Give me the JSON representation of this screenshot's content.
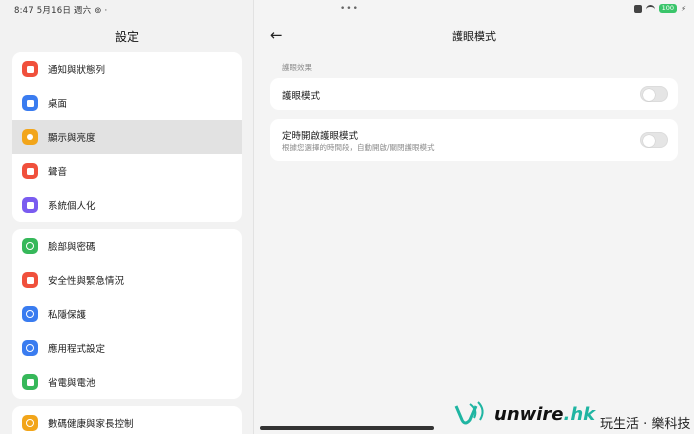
{
  "status": {
    "time_date": "8:47  5月16日 週六  ⊚ ·",
    "battery": "100",
    "dots": "•••"
  },
  "left": {
    "title": "設定",
    "groups": [
      [
        {
          "label": "通知與狀態列",
          "icon": "notification-icon",
          "color": "#f0503c"
        },
        {
          "label": "桌面",
          "icon": "home-icon",
          "color": "#3a7cf0"
        },
        {
          "label": "顯示與亮度",
          "icon": "sun-icon",
          "color": "#f2a51a",
          "selected": true
        },
        {
          "label": "聲音",
          "icon": "sound-icon",
          "color": "#f0503c"
        },
        {
          "label": "系統個人化",
          "icon": "brush-icon",
          "color": "#7a5cf0"
        }
      ],
      [
        {
          "label": "臉部與密碼",
          "icon": "face-lock-icon",
          "color": "#36b85a"
        },
        {
          "label": "安全性與緊急情況",
          "icon": "emergency-icon",
          "color": "#f0503c"
        },
        {
          "label": "私隱保護",
          "icon": "privacy-icon",
          "color": "#3a7cf0"
        },
        {
          "label": "應用程式設定",
          "icon": "app-settings-icon",
          "color": "#3a7cf0"
        },
        {
          "label": "省電與電池",
          "icon": "battery-icon",
          "color": "#36b85a"
        }
      ],
      [
        {
          "label": "數碼健康與家長控制",
          "icon": "wellbeing-icon",
          "color": "#f2a51a"
        }
      ]
    ]
  },
  "right": {
    "title": "護眼模式",
    "section": "護眼效果",
    "eye_mode": {
      "label": "護眼模式",
      "on": false
    },
    "schedule": {
      "label": "定時開啟護眼模式",
      "sub": "根據您選擇的時間段，自動開啟/關閉護眼模式",
      "on": false
    }
  },
  "watermark": {
    "brand": "unwire",
    "tld": ".hk",
    "slogan": "玩生活 · 樂科技"
  }
}
